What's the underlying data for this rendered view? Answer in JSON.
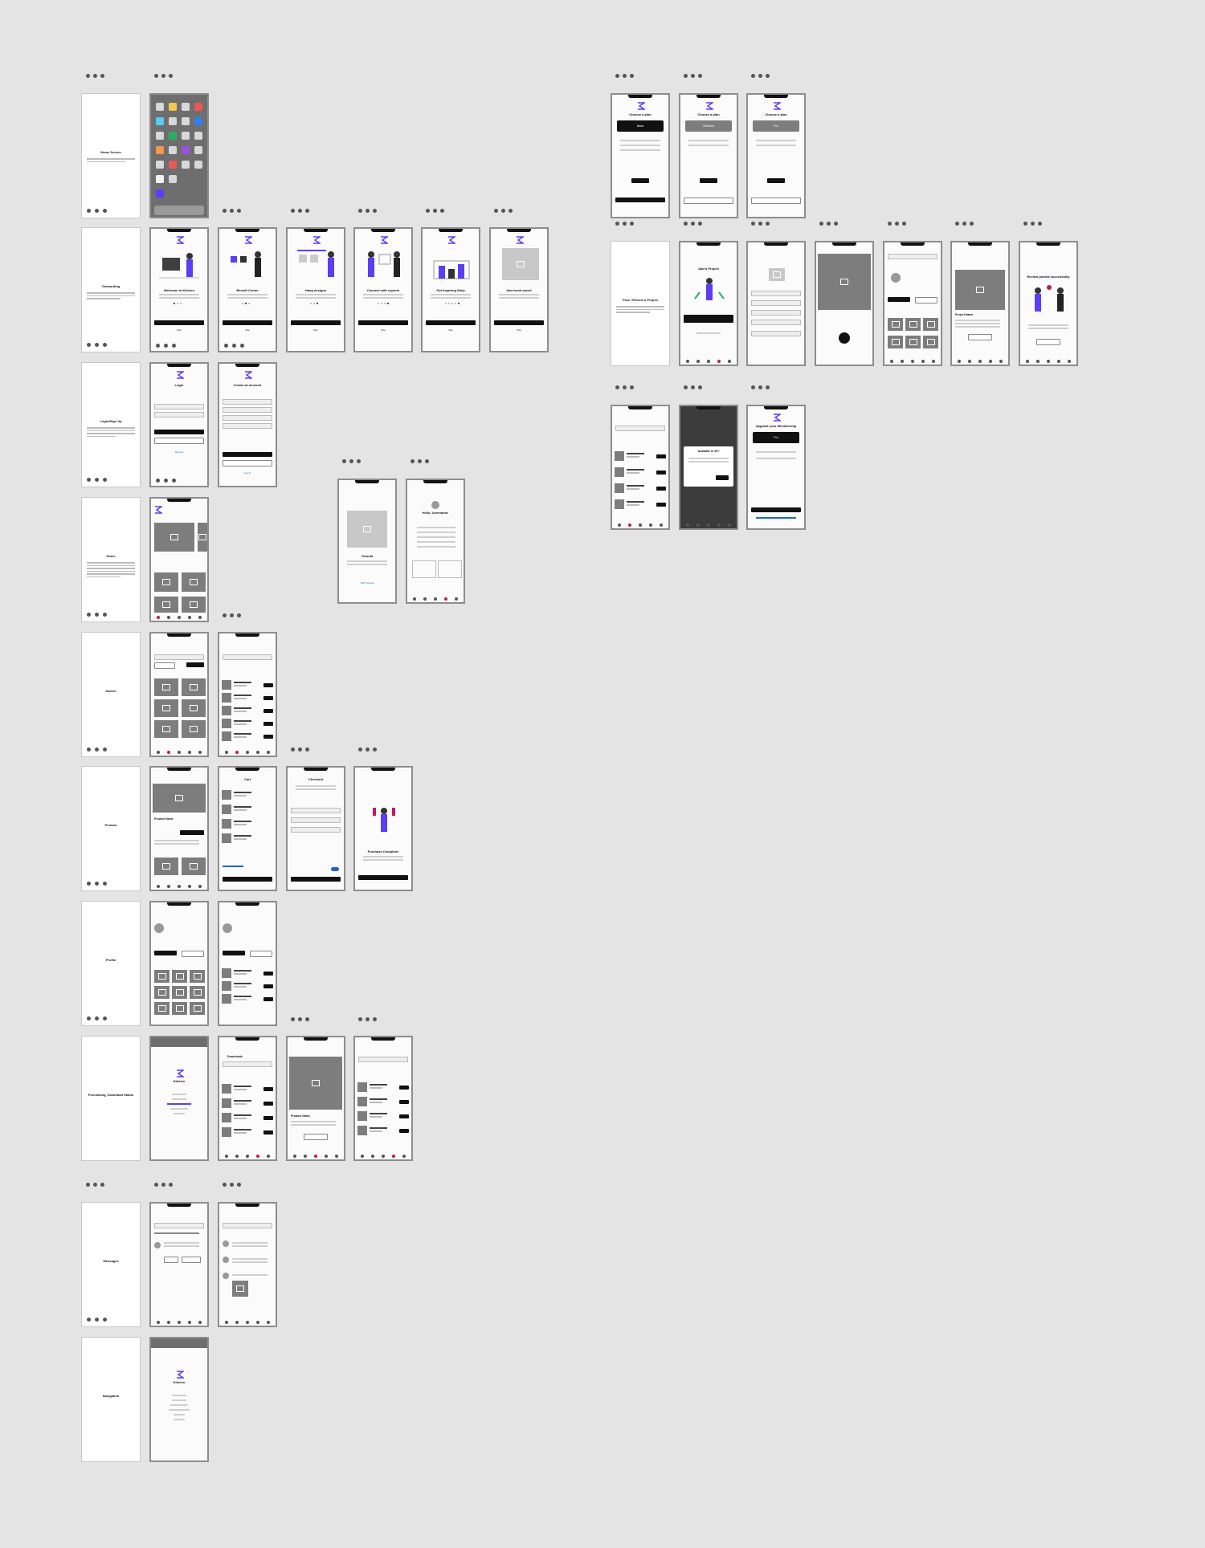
{
  "colors": {
    "canvas": "#e4e4e4",
    "accent": "#5b3df5",
    "secondary_accent": "#c2185b",
    "dark": "#111111",
    "placeholder": "#7d7d7d",
    "link": "#1e63d6"
  },
  "sections": [
    {
      "title": "Home Screen"
    },
    {
      "title": "Onboarding"
    },
    {
      "title": "Login/Sign Up"
    },
    {
      "title": "Home"
    },
    {
      "title": "Search"
    },
    {
      "title": "Product"
    },
    {
      "title": "Profile"
    },
    {
      "title": "Purchasing, Download Status"
    },
    {
      "title": "Messages"
    },
    {
      "title": "Navigation"
    }
  ],
  "onboarding": {
    "titles": [
      "Welcome to Kitchen",
      "Benefit Center",
      "Hang designs",
      "Connect with experts",
      "Get Inspiring Daily",
      "Idea book saved"
    ],
    "skip": "Skip"
  },
  "login": {
    "title": "Login",
    "link": "Sign Up"
  },
  "create_account": {
    "title": "Create an account",
    "link": "Log In"
  },
  "tutorial": {
    "title": "Tutorial",
    "link": "Skip Tutorial"
  },
  "checklist": {
    "title": "Hello, Username!"
  },
  "cart": {
    "title": "Cart"
  },
  "checkout": {
    "title": "Checkout"
  },
  "purchase": {
    "title": "Purchase Complete!"
  },
  "download": {
    "title": "Downloads"
  },
  "product": {
    "title": "Product Name"
  },
  "menu": {
    "title": "Kitchen"
  },
  "plans": {
    "title": "Choose a plan",
    "items": [
      "Basic",
      "Platinum",
      "Pro"
    ]
  },
  "upgrade": {
    "title": "Upgrade your Membership"
  },
  "post_project": {
    "title": "Post / Review a Project"
  },
  "project_add": {
    "title": "Add a Project"
  },
  "project_name": {
    "title": "Project Name"
  },
  "review_done": {
    "title": "Review posted successfully"
  },
  "available_msg": {
    "title": "Available in 4K+"
  }
}
